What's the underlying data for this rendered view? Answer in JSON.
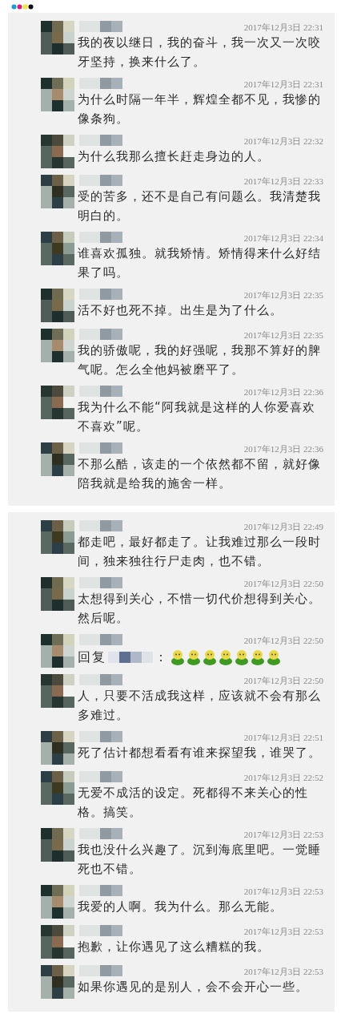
{
  "panels": [
    {
      "messages": [
        {
          "kind": "text",
          "time": "2017年12月3日 22:31",
          "text": "我的夜以继日，我的奋斗，我一次又一次咬牙坚持，换来什么了。"
        },
        {
          "kind": "text",
          "time": "2017年12月3日 22:31",
          "text": "为什么时隔一年半，辉煌全都不见，我惨的像条狗。"
        },
        {
          "kind": "text",
          "time": "2017年12月3日 22:32",
          "text": "为什么我那么擅长赶走身边的人。"
        },
        {
          "kind": "text",
          "time": "2017年12月3日 22:33",
          "text": "受的苦多，还不是自己有问题么。我清楚我明白的。"
        },
        {
          "kind": "text",
          "time": "2017年12月3日 22:34",
          "text": "谁喜欢孤独。就我矫情。矫情得来什么好结果了吗。"
        },
        {
          "kind": "text",
          "time": "2017年12月3日 22:35",
          "text": "活不好也死不掉。出生是为了什么。"
        },
        {
          "kind": "text",
          "time": "2017年12月3日 22:35",
          "text": "我的骄傲呢，我的好强呢，我那不算好的脾气呢。怎么全他妈被磨平了。"
        },
        {
          "kind": "text",
          "time": "2017年12月3日 22:36",
          "text": "我为什么不能“阿我就是这样的人你爱喜欢不喜欢”呢。"
        },
        {
          "kind": "text",
          "time": "2017年12月3日 22:36",
          "text": "不那么酷，该走的一个依然都不留，就好像陪我就是给我的施舍一样。"
        }
      ]
    },
    {
      "messages": [
        {
          "kind": "text",
          "time": "2017年12月3日 22:49",
          "text": "都走吧，最好都走了。让我难过那么一段时间，独来独往行尸走肉，也不错。"
        },
        {
          "kind": "text",
          "time": "2017年12月3日 22:50",
          "text": "太想得到关心，不惜一切代价想得到关心。然后呢。"
        },
        {
          "kind": "reply",
          "time": "2017年12月3日 22:50",
          "prefix": "回复",
          "suffix": "：",
          "emoticons": [
            {
              "kind": "emoticon"
            },
            {
              "kind": "emoticon"
            },
            {
              "kind": "emoticon"
            },
            {
              "kind": "emoticon"
            },
            {
              "kind": "emoticon"
            },
            {
              "kind": "emoticon"
            },
            {
              "kind": "emoticon"
            }
          ]
        },
        {
          "kind": "text",
          "time": "2017年12月3日 22:50",
          "text": "人，只要不活成我这样，应该就不会有那么多难过。"
        },
        {
          "kind": "text",
          "time": "2017年12月3日 22:51",
          "text": "死了估计都想看看有谁来探望我，谁哭了。"
        },
        {
          "kind": "text",
          "time": "2017年12月3日 22:52",
          "text": "无爱不成活的设定。死都得不来关心的性格。搞笑。"
        },
        {
          "kind": "text",
          "time": "2017年12月3日 22:53",
          "text": "我也没什么兴趣了。沉到海底里吧。一觉睡死也不错。"
        },
        {
          "kind": "text",
          "time": "2017年12月3日 22:53",
          "text": "我爱的人啊。我为什么。那么无能。"
        },
        {
          "kind": "text",
          "time": "2017年12月3日 22:53",
          "text": "抱歉，让你遇见了这么糟糕的我。"
        },
        {
          "kind": "text",
          "time": "2017年12月3日 22:53",
          "text": "如果你遇见的是别人，会不会开心一些。"
        }
      ]
    }
  ]
}
